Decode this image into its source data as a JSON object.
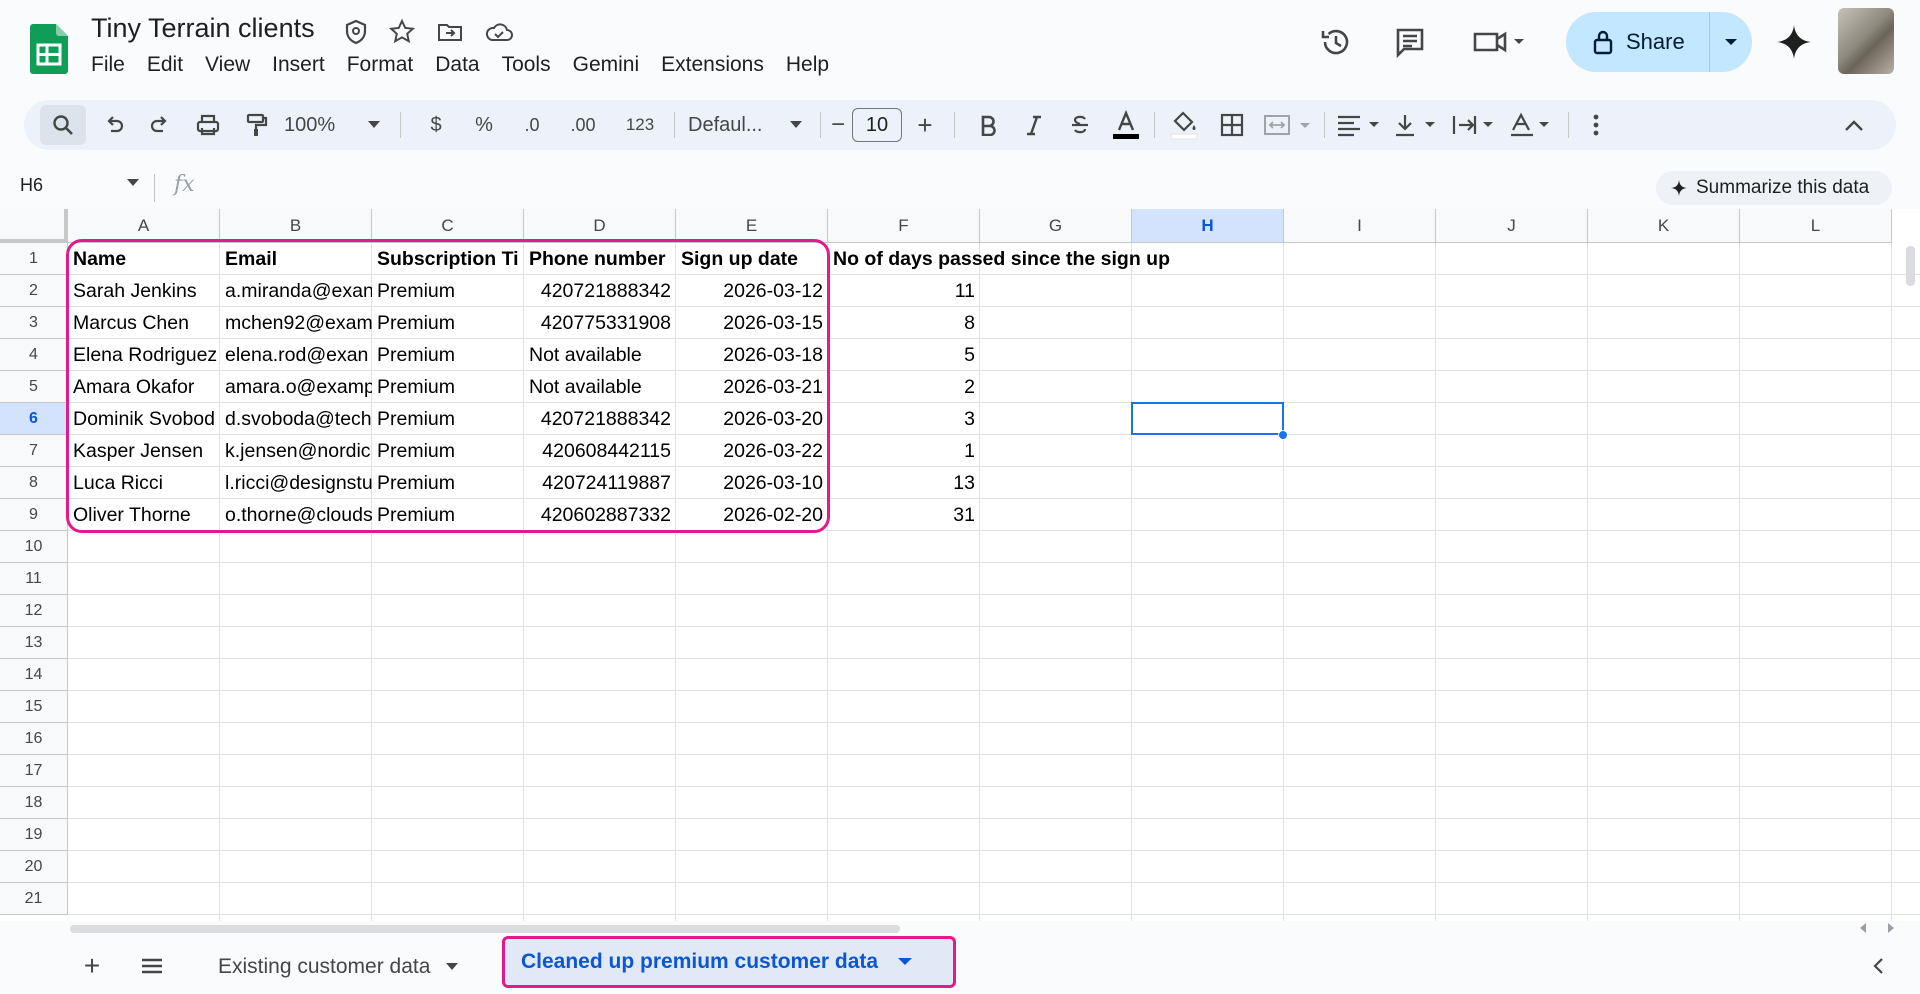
{
  "app": {
    "title": "Tiny Terrain clients",
    "menu": [
      "File",
      "Edit",
      "View",
      "Insert",
      "Format",
      "Data",
      "Tools",
      "Gemini",
      "Extensions",
      "Help"
    ],
    "share_label": "Share",
    "title_icons": [
      "star-icon",
      "move-folder-icon",
      "cloud-status-icon",
      "security-shield-icon"
    ]
  },
  "toolbar": {
    "zoom": "100%",
    "currency": "$",
    "percent": "%",
    "dec_decrease": ".0",
    "dec_increase": ".00",
    "number_format": "123",
    "font": "Defaul...",
    "font_size": "10",
    "minus": "−",
    "plus": "+"
  },
  "formula": {
    "name_box": "H6",
    "fx": "fx",
    "summarize": "Summarize this data"
  },
  "grid": {
    "columns": [
      "A",
      "B",
      "C",
      "D",
      "E",
      "F",
      "G",
      "H",
      "I",
      "J",
      "K",
      "L"
    ],
    "selected_column": "H",
    "rows": [
      "1",
      "2",
      "3",
      "4",
      "5",
      "6",
      "7",
      "8",
      "9",
      "10",
      "11",
      "12",
      "13",
      "14",
      "15",
      "16",
      "17",
      "18",
      "19",
      "20",
      "21"
    ],
    "selected_row": "6",
    "headers": [
      "Name",
      "Email",
      "Subscription Ti",
      "Phone number",
      "Sign up date",
      "No of days passed since the sign up"
    ],
    "data": [
      [
        "Sarah Jenkins",
        "a.miranda@exan",
        "Premium",
        "420721888342",
        "2026-03-12",
        "11"
      ],
      [
        "Marcus Chen",
        "mchen92@exam",
        "Premium",
        "420775331908",
        "2026-03-15",
        "8"
      ],
      [
        "Elena Rodriguez",
        "elena.rod@exan",
        "Premium",
        "Not available",
        "2026-03-18",
        "5"
      ],
      [
        "Amara Okafor",
        "amara.o@examp",
        "Premium",
        "Not available",
        "2026-03-21",
        "2"
      ],
      [
        "Dominik Svobod",
        "d.svoboda@tech",
        "Premium",
        "420721888342",
        "2026-03-20",
        "3"
      ],
      [
        "Kasper Jensen",
        "k.jensen@nordic",
        "Premium",
        "420608442115",
        "2026-03-22",
        "1"
      ],
      [
        "Luca Ricci",
        "l.ricci@designstu",
        "Premium",
        "420724119887",
        "2026-03-10",
        "13"
      ],
      [
        "Oliver Thorne",
        "o.thorne@clouds",
        "Premium",
        "420602887332",
        "2026-02-20",
        "31"
      ]
    ]
  },
  "sheets": {
    "tabs": [
      "Existing customer data",
      "Cleaned up premium customer data"
    ],
    "active": "Cleaned up premium customer data",
    "add": "+"
  },
  "colors": {
    "accent": "#0b57d0",
    "highlight": "#e5198a",
    "share_bg": "#c2e7ff",
    "selection": "#1a73e8"
  }
}
